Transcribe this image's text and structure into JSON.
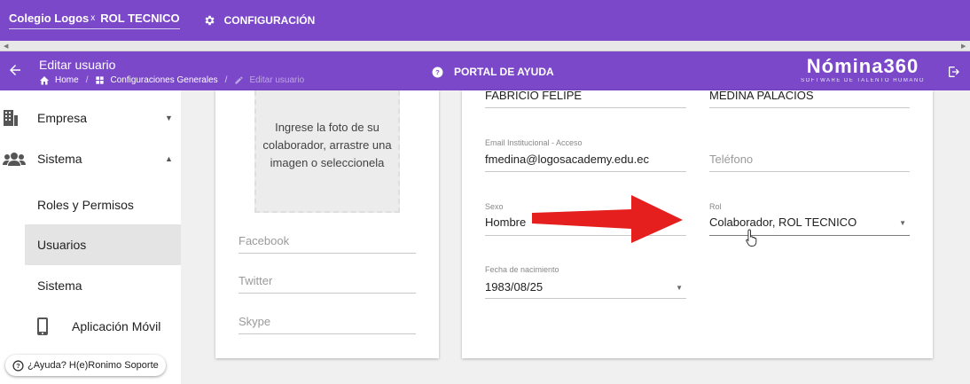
{
  "topbar": {
    "org_name": "Colegio Logos",
    "separator": "x",
    "role_name": "ROL TECNICO",
    "config_label": "CONFIGURACIÓN"
  },
  "subbar": {
    "title": "Editar usuario",
    "breadcrumb": [
      "Home",
      "Configuraciones Generales",
      "Editar usuario"
    ],
    "help_label": "PORTAL DE AYUDA",
    "brand": {
      "logo": "Nómina360",
      "tagline": "SOFTWARE DE TALENTO HUMANO"
    }
  },
  "sidebar": {
    "items": [
      {
        "label": "Empresa",
        "icon": "building-icon",
        "caret": "▼"
      },
      {
        "label": "Sistema",
        "icon": "users-group-icon",
        "caret": "▲"
      },
      {
        "label": "Roles y Permisos"
      },
      {
        "label": "Usuarios"
      },
      {
        "label": "Sistema"
      },
      {
        "label": "Aplicación Móvil",
        "icon": "mobile-phone-icon"
      }
    ],
    "help_chip": "¿Ayuda? H(e)Ronimo Soporte"
  },
  "photo_upload": {
    "text": "Ingrese la foto de su colaborador, arrastre una imagen o seleccionela"
  },
  "social": {
    "facebook_placeholder": "Facebook",
    "twitter_placeholder": "Twitter",
    "skype_placeholder": "Skype"
  },
  "form": {
    "first_name": "FABRICIO FELIPE",
    "last_name": "MEDINA PALACIOS",
    "email_label": "Email Institucional - Acceso",
    "email_value": "fmedina@logosacademy.edu.ec",
    "phone_placeholder": "Teléfono",
    "sex_label": "Sexo",
    "sex_value": "Hombre",
    "role_label": "Rol",
    "role_value": "Colaborador, ROL TECNICO",
    "birth_label": "Fecha de nacimiento",
    "birth_value": "1983/08/25",
    "dropdown_arrow": "▼"
  },
  "colors": {
    "primary": "#7a48c8",
    "annotation_arrow": "#e51e1e"
  }
}
